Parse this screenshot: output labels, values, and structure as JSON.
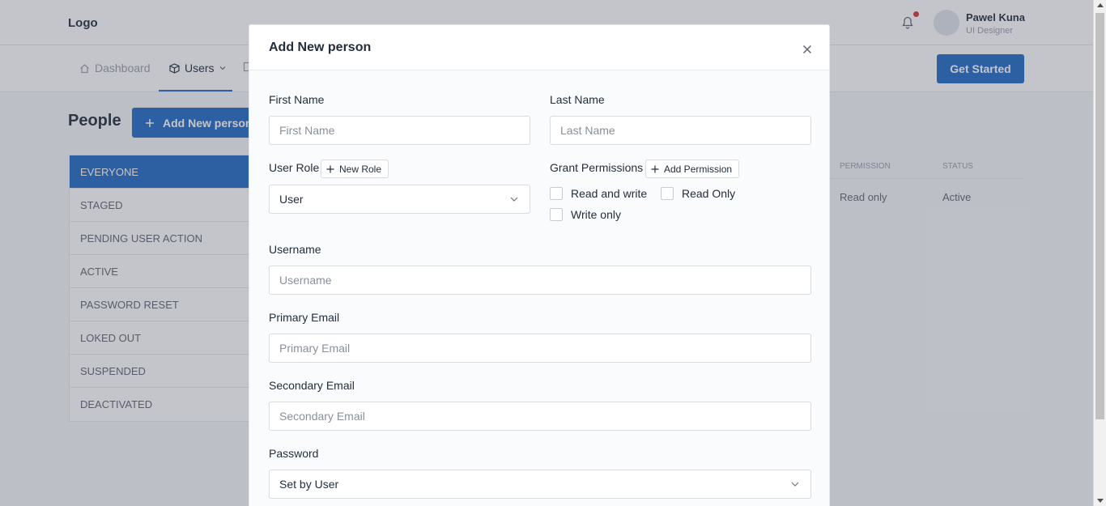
{
  "app": {
    "logo": "Logo",
    "user": {
      "name": "Pawel Kuna",
      "role": "UI Designer"
    },
    "nav": {
      "dashboard": "Dashboard",
      "users": "Users",
      "get_started": "Get Started"
    },
    "page_title": "People",
    "add_person": "Add New person",
    "filters": [
      "EVERYONE",
      "STAGED",
      "PENDING USER ACTION",
      "ACTIVE",
      "PASSWORD RESET",
      "LOKED OUT",
      "SUSPENDED",
      "DEACTIVATED"
    ],
    "table": {
      "headers": {
        "permission": "PERMISSION",
        "status": "STATUS"
      },
      "row": {
        "permission": "Read only",
        "status": "Active"
      }
    }
  },
  "modal": {
    "title": "Add New person",
    "first_name": {
      "label": "First Name",
      "placeholder": "First Name"
    },
    "last_name": {
      "label": "Last Name",
      "placeholder": "Last Name"
    },
    "user_role": {
      "label": "User Role",
      "new_role": "New Role",
      "value": "User"
    },
    "permissions": {
      "label": "Grant Permissions",
      "add": "Add Permission",
      "options": [
        "Read and write",
        "Read Only",
        "Write only"
      ]
    },
    "username": {
      "label": "Username",
      "placeholder": "Username"
    },
    "primary_email": {
      "label": "Primary Email",
      "placeholder": "Primary Email"
    },
    "secondary_email": {
      "label": "Secondary Email",
      "placeholder": "Secondary Email"
    },
    "password": {
      "label": "Password",
      "value": "Set by User"
    }
  },
  "colors": {
    "primary": "#206bc4",
    "notification": "#d63939"
  }
}
